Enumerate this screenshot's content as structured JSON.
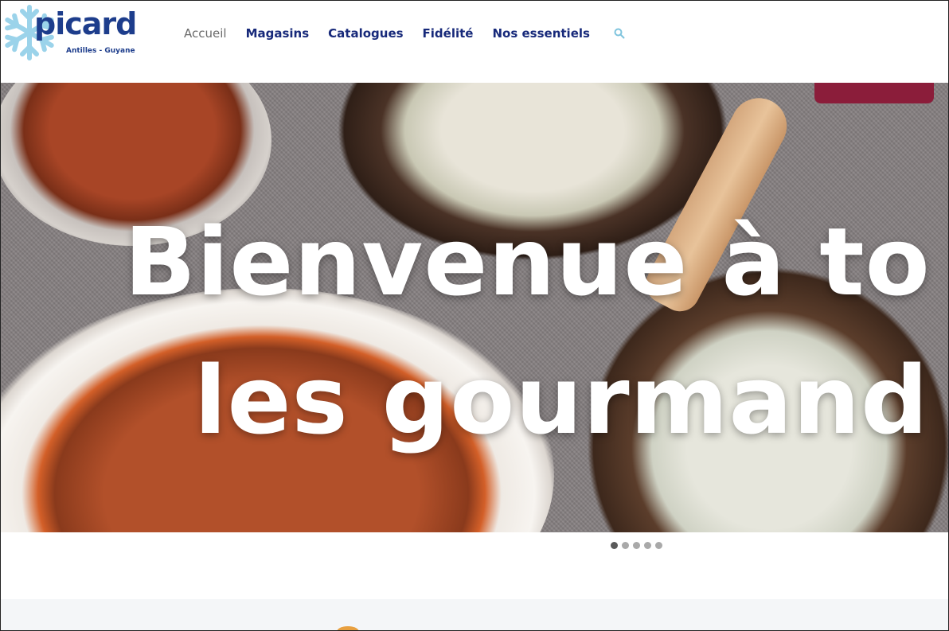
{
  "brand": {
    "name": "picard",
    "region": "Antilles - Guyane",
    "logo_icon": "snowflake-icon",
    "colors": {
      "primary": "#1d3d8c",
      "snowflake": "#9bd3ea"
    }
  },
  "nav": {
    "items": [
      {
        "label": "Accueil",
        "active": true
      },
      {
        "label": "Magasins",
        "active": false
      },
      {
        "label": "Catalogues",
        "active": false
      },
      {
        "label": "Fidélité",
        "active": false
      },
      {
        "label": "Nos essentiels",
        "active": false
      }
    ],
    "search_icon": "search-icon",
    "colors": {
      "link": "#17297a",
      "active": "#6a6a6a",
      "search": "#7fc4dd"
    }
  },
  "hero": {
    "title_line1": "Bienvenue à to",
    "title_line2": "les gourmand"
  },
  "carousel": {
    "slides": 5,
    "active_index": 0
  }
}
